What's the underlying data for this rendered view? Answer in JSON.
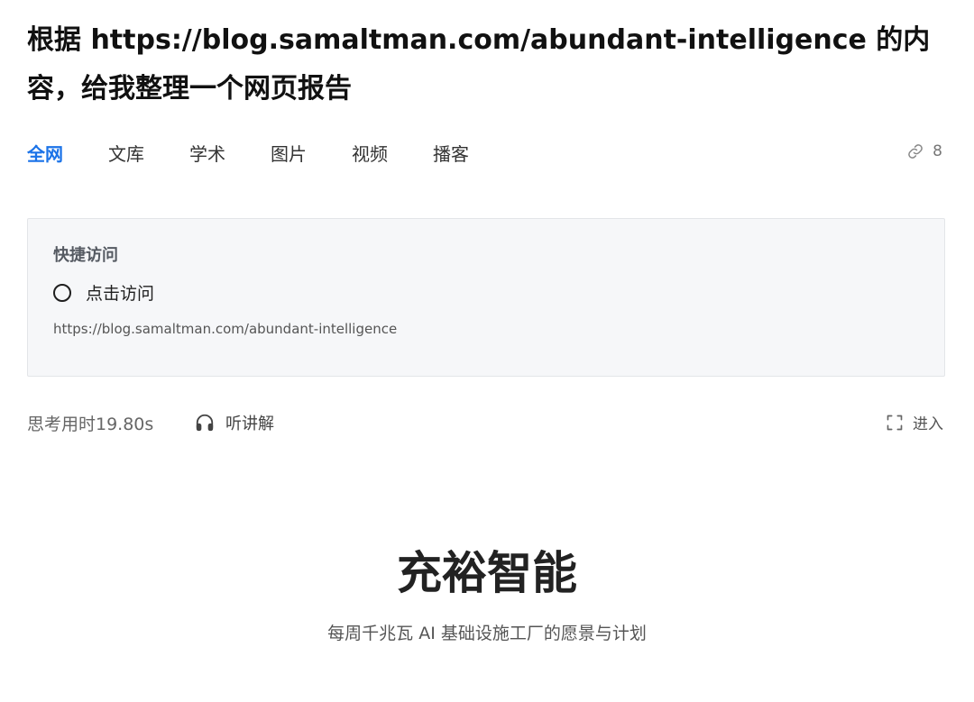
{
  "query": {
    "text": "根据 https://blog.samaltman.com/abundant-intelligence 的内容，给我整理一个网页报告"
  },
  "tabs": [
    {
      "label": "全网",
      "active": true
    },
    {
      "label": "文库",
      "active": false
    },
    {
      "label": "学术",
      "active": false
    },
    {
      "label": "图片",
      "active": false
    },
    {
      "label": "视频",
      "active": false
    },
    {
      "label": "播客",
      "active": false
    }
  ],
  "sources": {
    "count": "8",
    "icon": "link-icon"
  },
  "quick_access": {
    "title": "快捷访问",
    "action_label": "点击访问",
    "url": "https://blog.samaltman.com/abundant-intelligence"
  },
  "status": {
    "thinking_time": "思考用时19.80s",
    "listen_label": "听讲解",
    "enter_label": "进入"
  },
  "report": {
    "title": "充裕智能",
    "subtitle": "每周千兆瓦 AI 基础设施工厂的愿景与计划"
  },
  "colors": {
    "accent": "#1b73e8",
    "card_bg": "#f6f7f9",
    "card_border": "#e3e5e8"
  }
}
